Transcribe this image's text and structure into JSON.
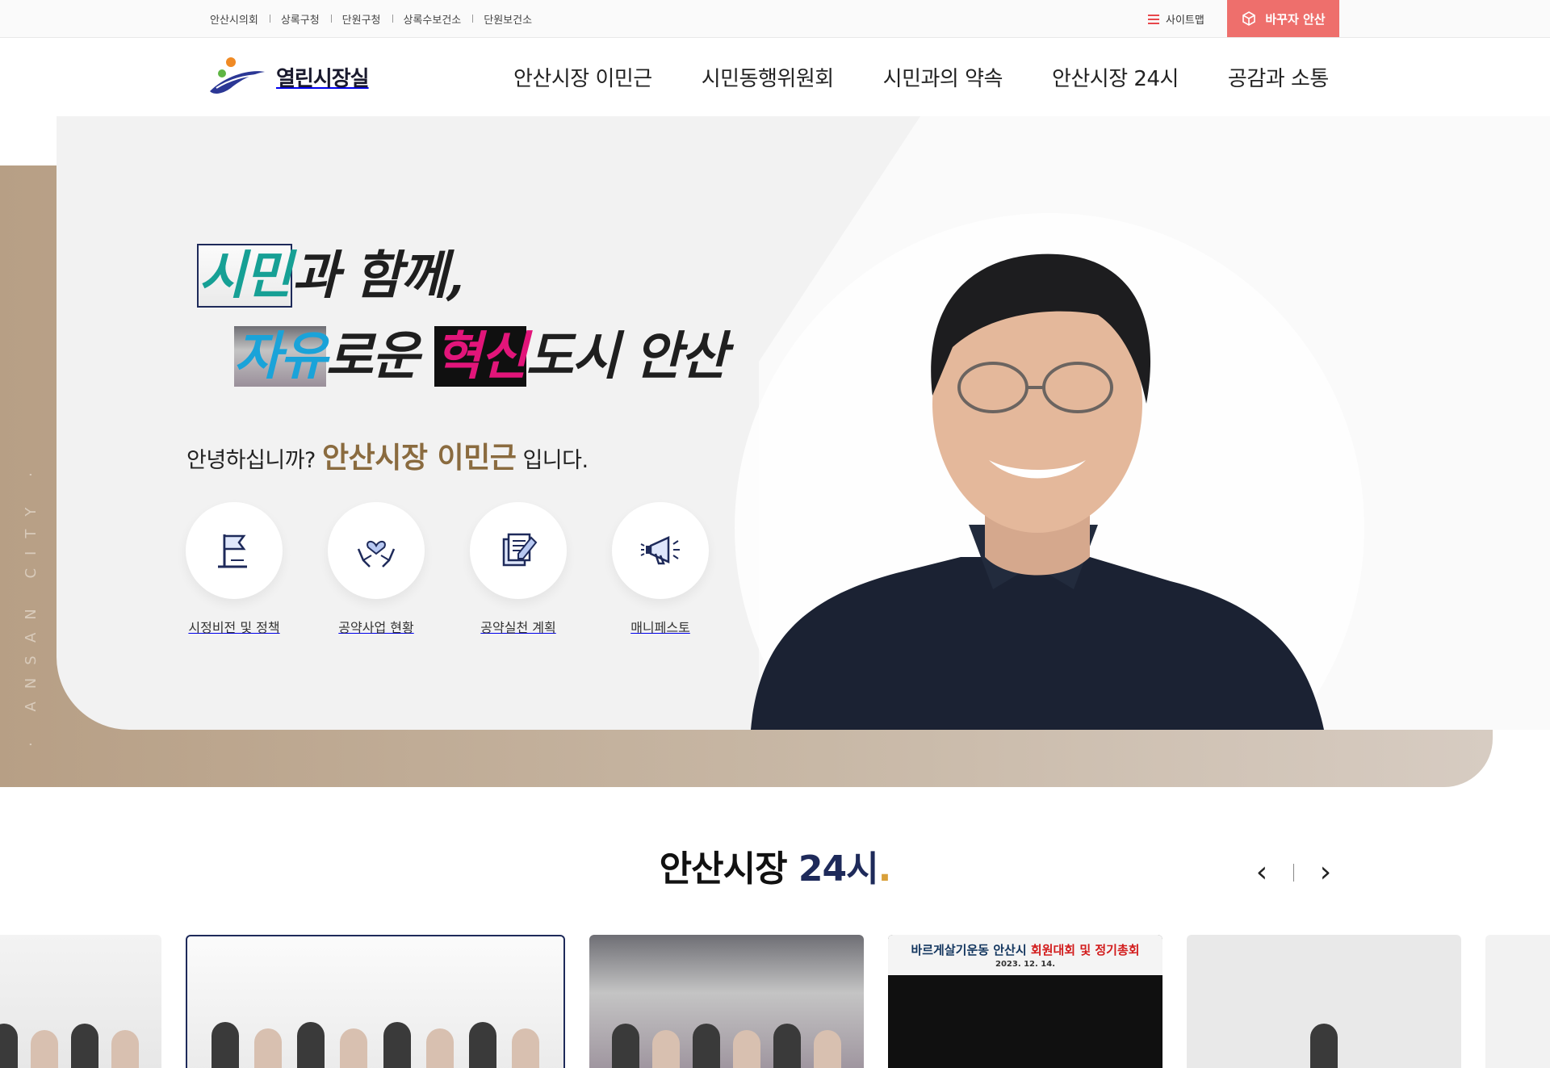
{
  "util": {
    "links": [
      "안산시의회",
      "상록구청",
      "단원구청",
      "상록수보건소",
      "단원보건소"
    ],
    "sitemap_label": "사이트맵",
    "brand_button_label": "바꾸자 안산"
  },
  "header": {
    "logo_text": "열린시장실",
    "nav": [
      "안산시장 이민근",
      "시민동행위원회",
      "시민과의 약속",
      "안산시장 24시",
      "공감과 소통"
    ]
  },
  "hero": {
    "vertical_text": "· ANSAN CITY ·",
    "slogan_line1_a": "시민",
    "slogan_line1_b": "과 함께,",
    "slogan_line2_a": "자유",
    "slogan_line2_b": "로운 ",
    "slogan_line2_c": "혁신",
    "slogan_line2_d": "도시 안산",
    "greeting_prefix": "안녕하십니까?",
    "greeting_name": "안산시장 이민근",
    "greeting_suffix": "입니다.",
    "quick_links": [
      {
        "label": "시정비전 및 정책",
        "icon": "flag-icon"
      },
      {
        "label": "공약사업 현황",
        "icon": "heart-hands-icon"
      },
      {
        "label": "공약실천 계획",
        "icon": "document-pen-icon"
      },
      {
        "label": "매니페스토",
        "icon": "megaphone-icon"
      }
    ]
  },
  "section24": {
    "title_a": "안산시장",
    "title_b": "24시",
    "title_dot": ".",
    "prev_label": "‹",
    "next_label": "›",
    "card3_caption_a": "바르게살기운동 안산시",
    "card3_caption_b": "회원대회 및 정기총회",
    "card3_date": "2023. 12. 14."
  },
  "colors": {
    "accent_red": "#ee6f6c",
    "brand_gold": "#8a6b3f",
    "navy": "#1e2a5a",
    "hero_band": "#b79f85"
  }
}
